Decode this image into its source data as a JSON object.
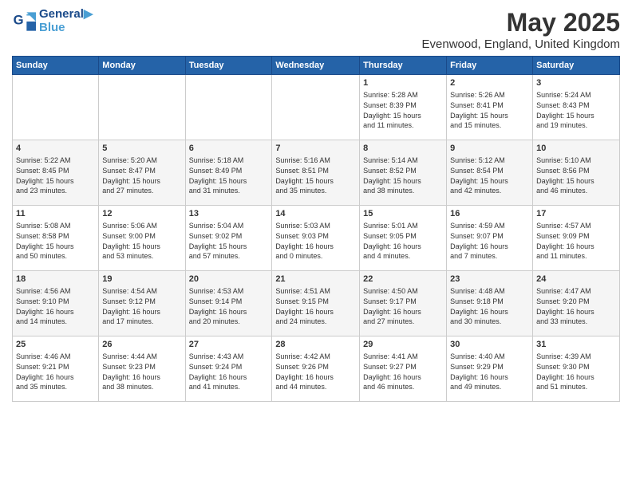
{
  "header": {
    "logo_line1": "General",
    "logo_line2": "Blue",
    "title": "May 2025",
    "subtitle": "Evenwood, England, United Kingdom"
  },
  "weekdays": [
    "Sunday",
    "Monday",
    "Tuesday",
    "Wednesday",
    "Thursday",
    "Friday",
    "Saturday"
  ],
  "weeks": [
    [
      {
        "day": "",
        "content": ""
      },
      {
        "day": "",
        "content": ""
      },
      {
        "day": "",
        "content": ""
      },
      {
        "day": "",
        "content": ""
      },
      {
        "day": "1",
        "content": "Sunrise: 5:28 AM\nSunset: 8:39 PM\nDaylight: 15 hours\nand 11 minutes."
      },
      {
        "day": "2",
        "content": "Sunrise: 5:26 AM\nSunset: 8:41 PM\nDaylight: 15 hours\nand 15 minutes."
      },
      {
        "day": "3",
        "content": "Sunrise: 5:24 AM\nSunset: 8:43 PM\nDaylight: 15 hours\nand 19 minutes."
      }
    ],
    [
      {
        "day": "4",
        "content": "Sunrise: 5:22 AM\nSunset: 8:45 PM\nDaylight: 15 hours\nand 23 minutes."
      },
      {
        "day": "5",
        "content": "Sunrise: 5:20 AM\nSunset: 8:47 PM\nDaylight: 15 hours\nand 27 minutes."
      },
      {
        "day": "6",
        "content": "Sunrise: 5:18 AM\nSunset: 8:49 PM\nDaylight: 15 hours\nand 31 minutes."
      },
      {
        "day": "7",
        "content": "Sunrise: 5:16 AM\nSunset: 8:51 PM\nDaylight: 15 hours\nand 35 minutes."
      },
      {
        "day": "8",
        "content": "Sunrise: 5:14 AM\nSunset: 8:52 PM\nDaylight: 15 hours\nand 38 minutes."
      },
      {
        "day": "9",
        "content": "Sunrise: 5:12 AM\nSunset: 8:54 PM\nDaylight: 15 hours\nand 42 minutes."
      },
      {
        "day": "10",
        "content": "Sunrise: 5:10 AM\nSunset: 8:56 PM\nDaylight: 15 hours\nand 46 minutes."
      }
    ],
    [
      {
        "day": "11",
        "content": "Sunrise: 5:08 AM\nSunset: 8:58 PM\nDaylight: 15 hours\nand 50 minutes."
      },
      {
        "day": "12",
        "content": "Sunrise: 5:06 AM\nSunset: 9:00 PM\nDaylight: 15 hours\nand 53 minutes."
      },
      {
        "day": "13",
        "content": "Sunrise: 5:04 AM\nSunset: 9:02 PM\nDaylight: 15 hours\nand 57 minutes."
      },
      {
        "day": "14",
        "content": "Sunrise: 5:03 AM\nSunset: 9:03 PM\nDaylight: 16 hours\nand 0 minutes."
      },
      {
        "day": "15",
        "content": "Sunrise: 5:01 AM\nSunset: 9:05 PM\nDaylight: 16 hours\nand 4 minutes."
      },
      {
        "day": "16",
        "content": "Sunrise: 4:59 AM\nSunset: 9:07 PM\nDaylight: 16 hours\nand 7 minutes."
      },
      {
        "day": "17",
        "content": "Sunrise: 4:57 AM\nSunset: 9:09 PM\nDaylight: 16 hours\nand 11 minutes."
      }
    ],
    [
      {
        "day": "18",
        "content": "Sunrise: 4:56 AM\nSunset: 9:10 PM\nDaylight: 16 hours\nand 14 minutes."
      },
      {
        "day": "19",
        "content": "Sunrise: 4:54 AM\nSunset: 9:12 PM\nDaylight: 16 hours\nand 17 minutes."
      },
      {
        "day": "20",
        "content": "Sunrise: 4:53 AM\nSunset: 9:14 PM\nDaylight: 16 hours\nand 20 minutes."
      },
      {
        "day": "21",
        "content": "Sunrise: 4:51 AM\nSunset: 9:15 PM\nDaylight: 16 hours\nand 24 minutes."
      },
      {
        "day": "22",
        "content": "Sunrise: 4:50 AM\nSunset: 9:17 PM\nDaylight: 16 hours\nand 27 minutes."
      },
      {
        "day": "23",
        "content": "Sunrise: 4:48 AM\nSunset: 9:18 PM\nDaylight: 16 hours\nand 30 minutes."
      },
      {
        "day": "24",
        "content": "Sunrise: 4:47 AM\nSunset: 9:20 PM\nDaylight: 16 hours\nand 33 minutes."
      }
    ],
    [
      {
        "day": "25",
        "content": "Sunrise: 4:46 AM\nSunset: 9:21 PM\nDaylight: 16 hours\nand 35 minutes."
      },
      {
        "day": "26",
        "content": "Sunrise: 4:44 AM\nSunset: 9:23 PM\nDaylight: 16 hours\nand 38 minutes."
      },
      {
        "day": "27",
        "content": "Sunrise: 4:43 AM\nSunset: 9:24 PM\nDaylight: 16 hours\nand 41 minutes."
      },
      {
        "day": "28",
        "content": "Sunrise: 4:42 AM\nSunset: 9:26 PM\nDaylight: 16 hours\nand 44 minutes."
      },
      {
        "day": "29",
        "content": "Sunrise: 4:41 AM\nSunset: 9:27 PM\nDaylight: 16 hours\nand 46 minutes."
      },
      {
        "day": "30",
        "content": "Sunrise: 4:40 AM\nSunset: 9:29 PM\nDaylight: 16 hours\nand 49 minutes."
      },
      {
        "day": "31",
        "content": "Sunrise: 4:39 AM\nSunset: 9:30 PM\nDaylight: 16 hours\nand 51 minutes."
      }
    ]
  ]
}
